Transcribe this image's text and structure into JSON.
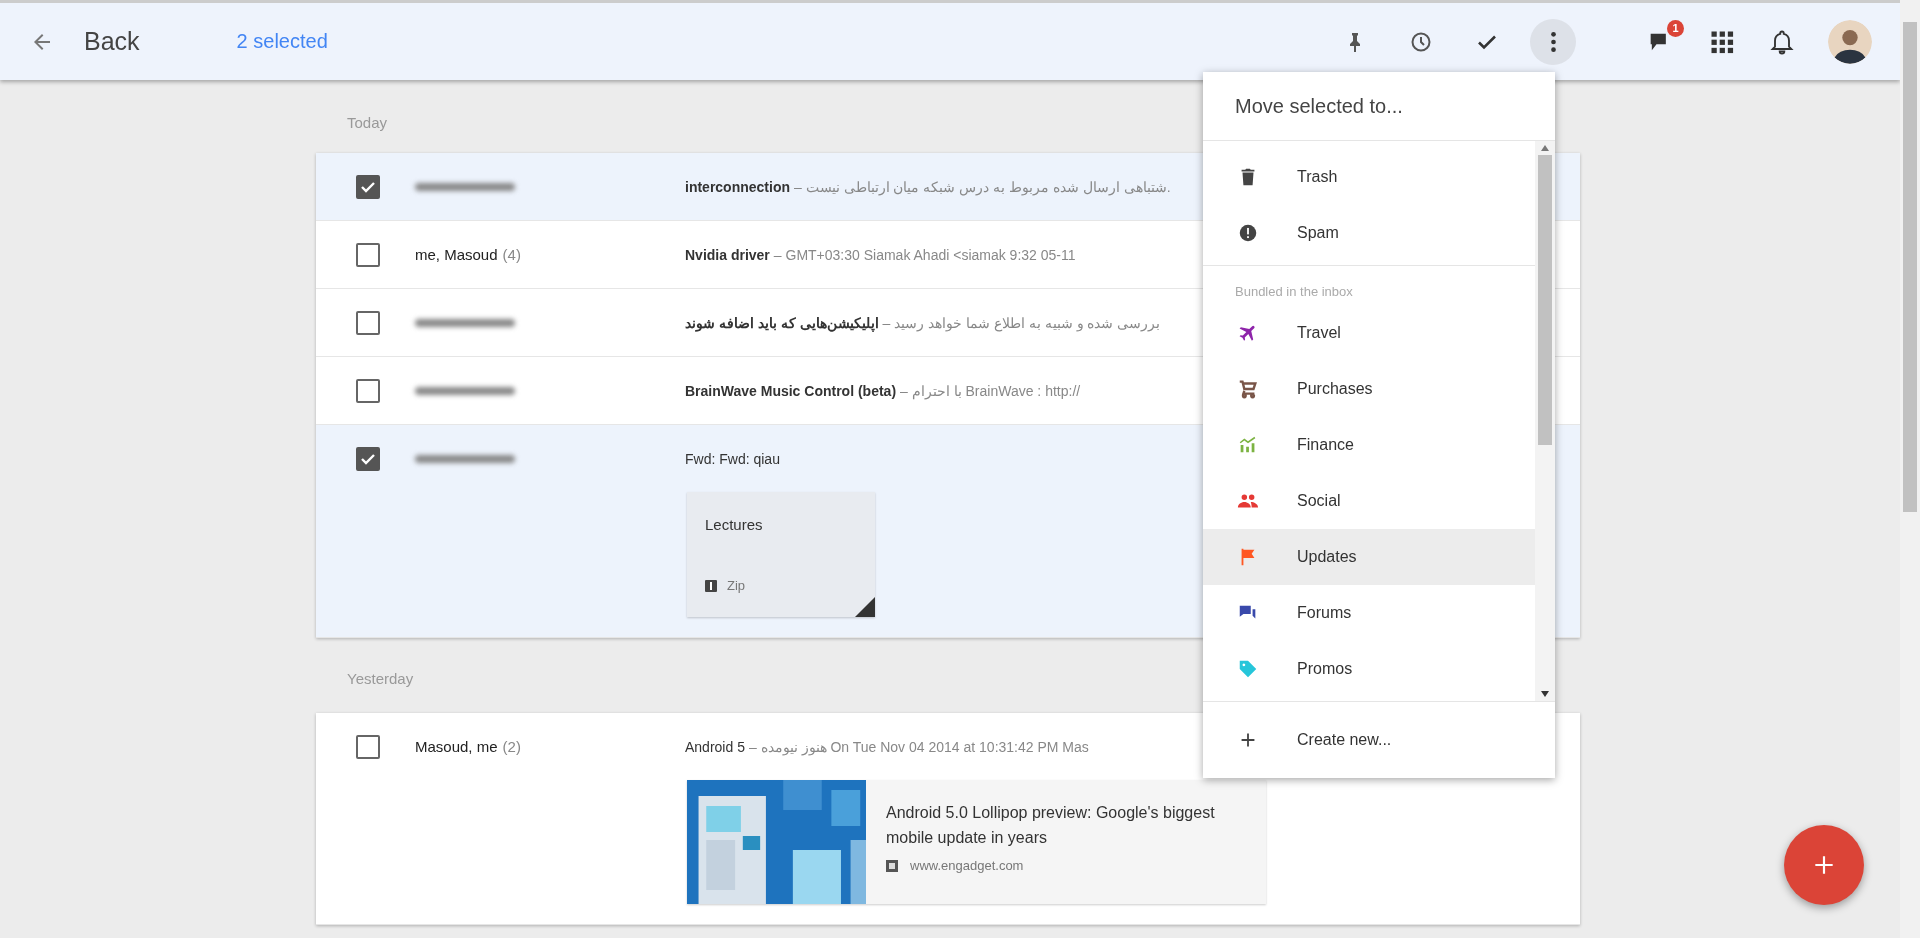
{
  "topbar": {
    "back_label": "Back",
    "selection_count": "2 selected",
    "actions": [
      {
        "kind": "pin",
        "selected": false
      },
      {
        "kind": "snooze",
        "selected": false
      },
      {
        "kind": "done",
        "selected": false
      },
      {
        "kind": "more",
        "selected": true
      }
    ],
    "chat_badge": "1"
  },
  "sections": [
    {
      "heading": "Today",
      "threads": [
        {
          "selected": true,
          "sender_blurred": true,
          "unread": true,
          "subject": "interconnection",
          "snippet": "– شتباهی ارسال شده مربوط به درس شبکه میان ارتباطی نیست."
        },
        {
          "selected": false,
          "sender_blurred": false,
          "sender": "me, Masoud",
          "count": "(4)",
          "unread": true,
          "subject": "Nvidia driver",
          "snippet": "– GMT+03:30 Siamak Ahadi <siamak 9:32 05-11"
        },
        {
          "selected": false,
          "sender_blurred": true,
          "unread": true,
          "subject": "اپلیکیشن‌هایی که باید اضافه شوند",
          "snippet": "– بررسی شده و شبیه به اطلاع شما خواهد رسید"
        },
        {
          "selected": false,
          "sender_blurred": true,
          "unread": true,
          "subject": "BrainWave Music Control (beta)",
          "snippet": "– با احترام BrainWave : http://"
        },
        {
          "selected": true,
          "sender_blurred": true,
          "unread": false,
          "subject": "Fwd: Fwd: qiau",
          "attachment": {
            "name": "Lectures",
            "type": "Zip"
          }
        }
      ]
    },
    {
      "heading": "Yesterday",
      "threads": [
        {
          "selected": false,
          "sender_blurred": false,
          "sender": "Masoud, me",
          "count": "(2)",
          "unread": false,
          "subject": "Android 5",
          "snippet": "– هنوز نیومده On Tue Nov 04 2014 at 10:31:42 PM Mas",
          "link_preview": {
            "kind": "picture",
            "title": "Android 5.0 Lollipop preview: Google's biggest mobile update in years",
            "url": "www.engadget.com"
          }
        }
      ]
    }
  ],
  "menu": {
    "title": "Move selected to...",
    "actions": [
      {
        "kind": "trash",
        "label": "Trash",
        "highlighted": false
      },
      {
        "kind": "spam",
        "label": "Spam",
        "highlighted": false
      }
    ],
    "bundles_heading": "Bundled in the inbox",
    "bundles": [
      {
        "kind": "travel",
        "label": "Travel",
        "color": "#8e24aa",
        "highlighted": false
      },
      {
        "kind": "purchases",
        "label": "Purchases",
        "color": "#795548",
        "highlighted": false
      },
      {
        "kind": "finance",
        "label": "Finance",
        "color": "#7cb342",
        "highlighted": false
      },
      {
        "kind": "social",
        "label": "Social",
        "color": "#e53935",
        "highlighted": false
      },
      {
        "kind": "updates",
        "label": "Updates",
        "color": "#ff5722",
        "highlighted": true
      },
      {
        "kind": "forums",
        "label": "Forums",
        "color": "#3949ab",
        "highlighted": false
      },
      {
        "kind": "promos",
        "label": "Promos",
        "color": "#26c6da",
        "highlighted": false
      }
    ],
    "create_label": "Create new..."
  }
}
